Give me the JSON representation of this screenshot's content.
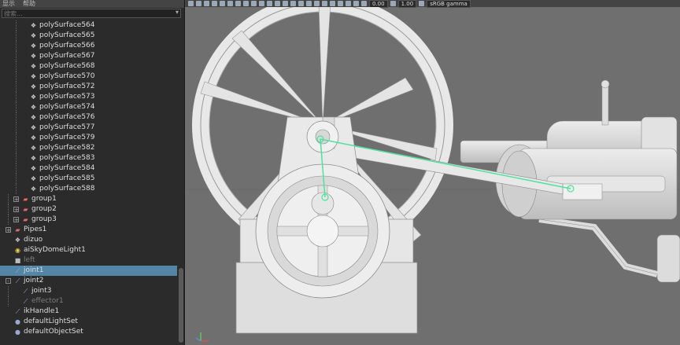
{
  "outliner": {
    "menu": [
      "显示",
      "帮助"
    ],
    "search_placeholder": "搜索...",
    "items": [
      {
        "label": "polySurface564",
        "icon": "mesh-icon",
        "indent": 2
      },
      {
        "label": "polySurface565",
        "icon": "mesh-icon",
        "indent": 2
      },
      {
        "label": "polySurface566",
        "icon": "mesh-icon",
        "indent": 2
      },
      {
        "label": "polySurface567",
        "icon": "mesh-icon",
        "indent": 2
      },
      {
        "label": "polySurface568",
        "icon": "mesh-icon",
        "indent": 2
      },
      {
        "label": "polySurface570",
        "icon": "mesh-icon",
        "indent": 2
      },
      {
        "label": "polySurface572",
        "icon": "mesh-icon",
        "indent": 2
      },
      {
        "label": "polySurface573",
        "icon": "mesh-icon",
        "indent": 2
      },
      {
        "label": "polySurface574",
        "icon": "mesh-icon",
        "indent": 2
      },
      {
        "label": "polySurface576",
        "icon": "mesh-icon",
        "indent": 2
      },
      {
        "label": "polySurface577",
        "icon": "mesh-icon",
        "indent": 2
      },
      {
        "label": "polySurface579",
        "icon": "mesh-icon",
        "indent": 2
      },
      {
        "label": "polySurface582",
        "icon": "mesh-icon",
        "indent": 2
      },
      {
        "label": "polySurface583",
        "icon": "mesh-icon",
        "indent": 2
      },
      {
        "label": "polySurface584",
        "icon": "mesh-icon",
        "indent": 2
      },
      {
        "label": "polySurface585",
        "icon": "mesh-icon",
        "indent": 2
      },
      {
        "label": "polySurface588",
        "icon": "mesh-icon",
        "indent": 2
      },
      {
        "label": "group1",
        "icon": "group-icon",
        "indent": 1,
        "expander": "+"
      },
      {
        "label": "group2",
        "icon": "group-icon",
        "indent": 1,
        "expander": "+"
      },
      {
        "label": "group3",
        "icon": "group-icon",
        "indent": 1,
        "expander": "+"
      },
      {
        "label": "Pipes1",
        "icon": "group-icon",
        "indent": 0,
        "expander": "+"
      },
      {
        "label": "dizuo",
        "icon": "mesh-icon",
        "indent": 0
      },
      {
        "label": "aiSkyDomeLight1",
        "icon": "light-icon",
        "indent": 0
      },
      {
        "label": "left",
        "icon": "camera-icon",
        "indent": 0,
        "style": "dim"
      },
      {
        "label": "joint1",
        "icon": "joint-icon",
        "indent": 0,
        "selected": true
      },
      {
        "label": "joint2",
        "icon": "joint-icon",
        "indent": 0,
        "expander": "-"
      },
      {
        "label": "joint3",
        "icon": "joint-icon",
        "indent": 1
      },
      {
        "label": "effector1",
        "icon": "effector-icon",
        "indent": 1,
        "style": "dim"
      },
      {
        "label": "ikHandle1",
        "icon": "ikhandle-icon",
        "indent": 0
      },
      {
        "label": "defaultLightSet",
        "icon": "set-icon",
        "indent": 0
      },
      {
        "label": "defaultObjectSet",
        "icon": "set-icon",
        "indent": 0
      }
    ]
  },
  "viewport": {
    "toolbar": {
      "field1": "0.00",
      "field2": "1.00",
      "color_space": "sRGB gamma"
    },
    "background": "#6f6f6f",
    "joint_color": "#4de39a"
  },
  "icons": {
    "mesh-icon": "❖",
    "group-icon": "▰",
    "light-icon": "◉",
    "camera-icon": "■",
    "joint-icon": "⟋",
    "effector-icon": "⟋",
    "ikhandle-icon": "⟋",
    "set-icon": "●"
  }
}
